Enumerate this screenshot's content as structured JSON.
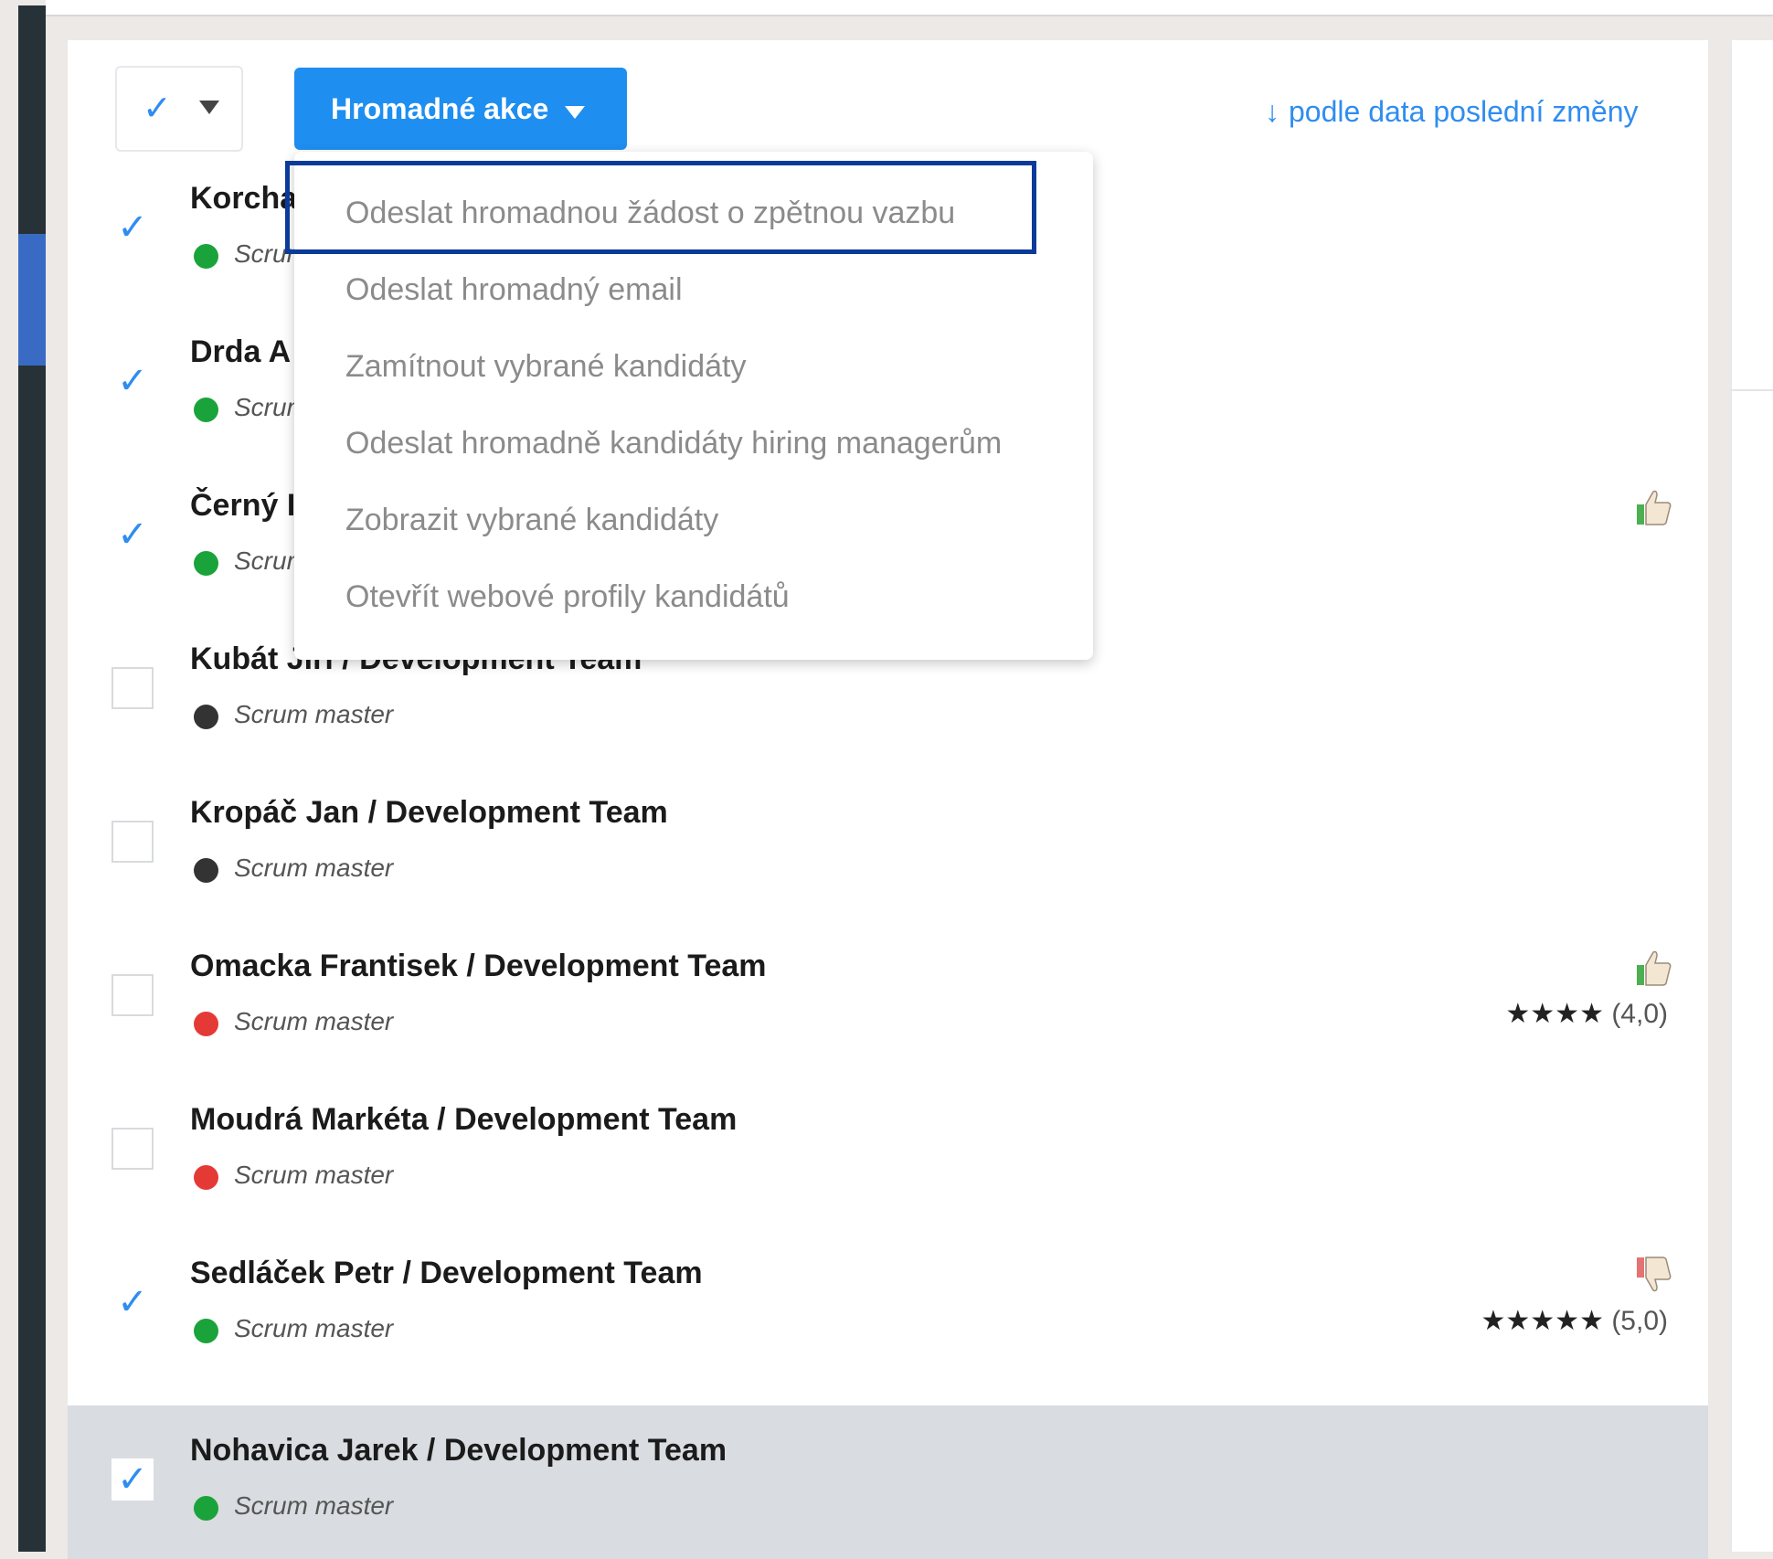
{
  "toolbar": {
    "select_all_check": "✓",
    "bulk_actions_label": "Hromadné akce",
    "sort_label": "podle data poslední změny"
  },
  "bulk_menu": {
    "items": [
      "Odeslat hromadnou žádost o zpětnou vazbu",
      "Odeslat hromadný email",
      "Zamítnout vybrané kandidáty",
      "Odeslat hromadně kandidáty hiring managerům",
      "Zobrazit vybrané kandidáty",
      "Otevřít webové profily kandidátů"
    ]
  },
  "candidates": [
    {
      "name": "Korcha",
      "role": "Scrum",
      "checked": true,
      "status_color": "#1aa33a"
    },
    {
      "name": "Drda A",
      "role": "Scrum",
      "checked": true,
      "status_color": "#1aa33a"
    },
    {
      "name": "Černý I",
      "role": "Scrum",
      "checked": true,
      "status_color": "#1aa33a",
      "thumb": "up"
    },
    {
      "name": "Kubát Jiří / Development Team",
      "role": "Scrum master",
      "checked": false,
      "status_color": "#333333"
    },
    {
      "name": "Kropáč Jan / Development Team",
      "role": "Scrum master",
      "checked": false,
      "status_color": "#333333"
    },
    {
      "name": "Omacka Frantisek / Development Team",
      "role": "Scrum master",
      "checked": false,
      "status_color": "#e53935",
      "thumb": "up",
      "stars": "★★★★",
      "rating": "(4,0)"
    },
    {
      "name": "Moudrá Markéta / Development Team",
      "role": "Scrum master",
      "checked": false,
      "status_color": "#e53935"
    },
    {
      "name": "Sedláček Petr / Development Team",
      "role": "Scrum master",
      "checked": true,
      "status_color": "#1aa33a",
      "thumb": "down",
      "stars": "★★★★★",
      "rating": "(5,0)"
    },
    {
      "name": "Nohavica Jarek / Development Team",
      "role": "Scrum master",
      "checked": true,
      "status_color": "#1aa33a",
      "highlighted": true
    }
  ],
  "colors": {
    "accent": "#1e8ef0",
    "sidebar": "#263238",
    "focus_ring": "#0b3a9a",
    "row_highlight": "#d9dce1"
  }
}
